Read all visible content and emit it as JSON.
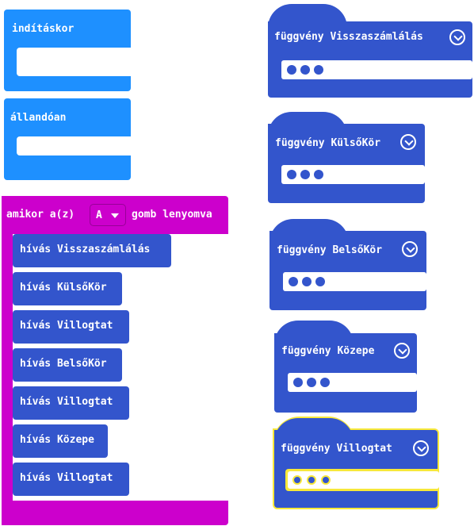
{
  "events": {
    "on_start": "indításkor",
    "forever": "állandóan",
    "on_button": {
      "prefix": "amikor a(z)",
      "button": "A",
      "suffix": "gomb lenyomva"
    }
  },
  "calls": [
    "hívás Visszaszámlálás",
    "hívás KülsőKör",
    "hívás Villogtat",
    "hívás BelsőKör",
    "hívás Villogtat",
    "hívás Közepe",
    "hívás Villogtat"
  ],
  "functions": [
    {
      "label": "függvény Visszaszámlálás",
      "selected": false
    },
    {
      "label": "függvény KülsőKör",
      "selected": false
    },
    {
      "label": "függvény BelsőKör",
      "selected": false
    },
    {
      "label": "függvény Közepe",
      "selected": false
    },
    {
      "label": "függvény Villogtat",
      "selected": true
    }
  ],
  "colors": {
    "event_blue": "#1e90ff",
    "input_magenta": "#cc00cc",
    "function_blue": "#3355cc",
    "selection_yellow": "#f7e83a"
  },
  "icons": {
    "dropdown": "chevron-down-icon",
    "params": "three-dots-icon",
    "button_picker": "triangle-down-icon"
  }
}
